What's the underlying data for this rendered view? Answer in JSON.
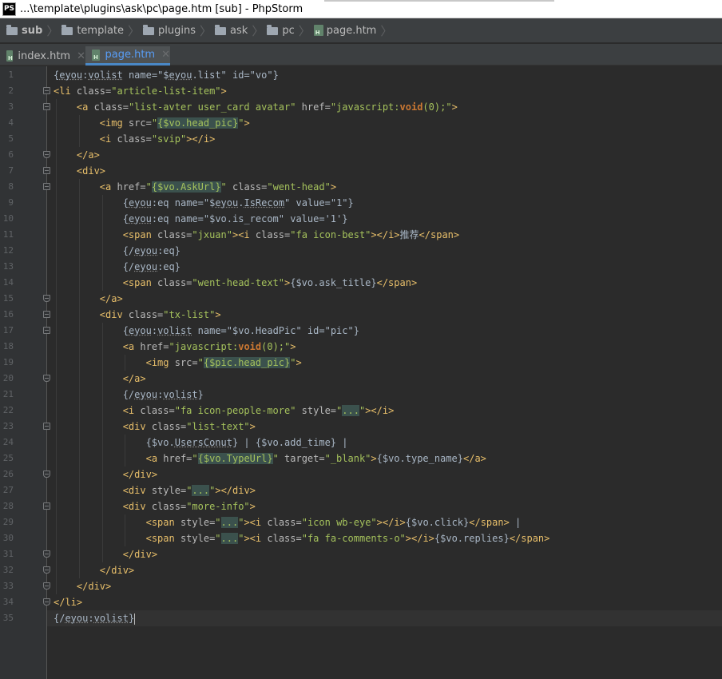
{
  "window": {
    "app_icon": "PS",
    "title": "...\\template\\plugins\\ask\\pc\\page.htm [sub] - PhpStorm"
  },
  "breadcrumb": [
    "sub",
    "template",
    "plugins",
    "ask",
    "pc",
    "page.htm"
  ],
  "tabs": [
    {
      "label": "index.htm",
      "active": false
    },
    {
      "label": "page.htm",
      "active": true
    }
  ],
  "colors": {
    "background": "#2b2b2b",
    "tag": "#e8bf6a",
    "attr_value": "#a5c25c",
    "keyword": "#cc7832",
    "active_tab": "#589df6"
  },
  "code": {
    "line_numbers": [
      "1",
      "2",
      "3",
      "4",
      "5",
      "6",
      "7",
      "8",
      "9",
      "10",
      "11",
      "12",
      "13",
      "14",
      "15",
      "16",
      "17",
      "18",
      "19",
      "20",
      "21",
      "22",
      "23",
      "24",
      "25",
      "26",
      "27",
      "28",
      "29",
      "30",
      "31",
      "32",
      "33",
      "34",
      "35"
    ],
    "lines": [
      [
        {
          "t": "{"
        },
        {
          "t": "eyou",
          "c": "ey"
        },
        {
          "t": ":"
        },
        {
          "t": "volist",
          "c": "ey"
        },
        {
          "t": " name=\"$"
        },
        {
          "t": "eyou",
          "c": "ey"
        },
        {
          "t": ".list\" id=\"vo\"}"
        }
      ],
      [
        {
          "t": "<li",
          "c": "tg"
        },
        {
          "t": " class=",
          "c": "an"
        },
        {
          "t": "\"article-list-item\"",
          "c": "av"
        },
        {
          "t": ">",
          "c": "tg"
        }
      ],
      [
        {
          "t": "<a",
          "c": "tg"
        },
        {
          "t": " class=",
          "c": "an"
        },
        {
          "t": "\"list-avter user_card avatar\"",
          "c": "av"
        },
        {
          "t": " href=",
          "c": "an"
        },
        {
          "t": "\"javascript:",
          "c": "av"
        },
        {
          "t": "void",
          "c": "kw"
        },
        {
          "t": "(0);",
          "c": "av"
        },
        {
          "t": "\"",
          "c": "av"
        },
        {
          "t": ">",
          "c": "tg"
        }
      ],
      [
        {
          "t": "<img",
          "c": "tg"
        },
        {
          "t": " src=",
          "c": "an"
        },
        {
          "t": "\"",
          "c": "av"
        },
        {
          "t": "{$vo.head_pic}",
          "c": "av hl"
        },
        {
          "t": "\"",
          "c": "av"
        },
        {
          "t": ">",
          "c": "tg"
        }
      ],
      [
        {
          "t": "<i",
          "c": "tg"
        },
        {
          "t": " class=",
          "c": "an"
        },
        {
          "t": "\"svip\"",
          "c": "av"
        },
        {
          "t": "></i>",
          "c": "tg"
        }
      ],
      [
        {
          "t": "</a>",
          "c": "tg"
        }
      ],
      [
        {
          "t": "<div>",
          "c": "tg"
        }
      ],
      [
        {
          "t": "<a",
          "c": "tg"
        },
        {
          "t": " href=",
          "c": "an"
        },
        {
          "t": "\"",
          "c": "av"
        },
        {
          "t": "{$vo.AskUrl}",
          "c": "av hl"
        },
        {
          "t": "\"",
          "c": "av"
        },
        {
          "t": " class=",
          "c": "an"
        },
        {
          "t": "\"went-head\"",
          "c": "av"
        },
        {
          "t": ">",
          "c": "tg"
        }
      ],
      [
        {
          "t": "{"
        },
        {
          "t": "eyou",
          "c": "ey"
        },
        {
          "t": ":eq name=\"$"
        },
        {
          "t": "eyou",
          "c": "ey"
        },
        {
          "t": "."
        },
        {
          "t": "IsRecom",
          "c": "ey"
        },
        {
          "t": "\" value=\"1\"}"
        }
      ],
      [
        {
          "t": "{"
        },
        {
          "t": "eyou",
          "c": "ey"
        },
        {
          "t": ":eq name=\"$vo.is_recom\" value='1'}"
        }
      ],
      [
        {
          "t": "<span",
          "c": "tg"
        },
        {
          "t": " class=",
          "c": "an"
        },
        {
          "t": "\"jxuan\"",
          "c": "av"
        },
        {
          "t": "><i",
          "c": "tg"
        },
        {
          "t": " class=",
          "c": "an"
        },
        {
          "t": "\"fa icon-best\"",
          "c": "av"
        },
        {
          "t": "></i>",
          "c": "tg"
        },
        {
          "t": "推荐"
        },
        {
          "t": "</span>",
          "c": "tg"
        }
      ],
      [
        {
          "t": "{/"
        },
        {
          "t": "eyou",
          "c": "ey"
        },
        {
          "t": ":eq}"
        }
      ],
      [
        {
          "t": "{/"
        },
        {
          "t": "eyou",
          "c": "ey"
        },
        {
          "t": ":eq}"
        }
      ],
      [
        {
          "t": "<span",
          "c": "tg"
        },
        {
          "t": " class=",
          "c": "an"
        },
        {
          "t": "\"went-head-text\"",
          "c": "av"
        },
        {
          "t": ">",
          "c": "tg"
        },
        {
          "t": "{$vo.ask_title}"
        },
        {
          "t": "</span>",
          "c": "tg"
        }
      ],
      [
        {
          "t": "</a>",
          "c": "tg"
        }
      ],
      [
        {
          "t": "<div",
          "c": "tg"
        },
        {
          "t": " class=",
          "c": "an"
        },
        {
          "t": "\"tx-list\"",
          "c": "av"
        },
        {
          "t": ">",
          "c": "tg"
        }
      ],
      [
        {
          "t": "{"
        },
        {
          "t": "eyou",
          "c": "ey"
        },
        {
          "t": ":"
        },
        {
          "t": "volist",
          "c": "ey"
        },
        {
          "t": " name=\"$vo.HeadPic\" id=\"pic\"}"
        }
      ],
      [
        {
          "t": "<a",
          "c": "tg"
        },
        {
          "t": " href=",
          "c": "an"
        },
        {
          "t": "\"javascript:",
          "c": "av"
        },
        {
          "t": "void",
          "c": "kw"
        },
        {
          "t": "(0);\"",
          "c": "av"
        },
        {
          "t": ">",
          "c": "tg"
        }
      ],
      [
        {
          "t": "<img",
          "c": "tg"
        },
        {
          "t": " src=",
          "c": "an"
        },
        {
          "t": "\"",
          "c": "av"
        },
        {
          "t": "{$pic.head_pic}",
          "c": "av hl"
        },
        {
          "t": "\"",
          "c": "av"
        },
        {
          "t": ">",
          "c": "tg"
        }
      ],
      [
        {
          "t": "</a>",
          "c": "tg"
        }
      ],
      [
        {
          "t": "{/"
        },
        {
          "t": "eyou",
          "c": "ey"
        },
        {
          "t": ":"
        },
        {
          "t": "volist",
          "c": "ey"
        },
        {
          "t": "}"
        }
      ],
      [
        {
          "t": "<i",
          "c": "tg"
        },
        {
          "t": " class=",
          "c": "an"
        },
        {
          "t": "\"fa icon-people-more\"",
          "c": "av"
        },
        {
          "t": " style=",
          "c": "an"
        },
        {
          "t": "\"",
          "c": "av"
        },
        {
          "t": "...",
          "c": "av hl"
        },
        {
          "t": "\"",
          "c": "av"
        },
        {
          "t": "></i>",
          "c": "tg"
        }
      ],
      [
        {
          "t": "<div",
          "c": "tg"
        },
        {
          "t": " class=",
          "c": "an"
        },
        {
          "t": "\"list-text\"",
          "c": "av"
        },
        {
          "t": ">",
          "c": "tg"
        }
      ],
      [
        {
          "t": "{$vo."
        },
        {
          "t": "UsersConut",
          "c": "ey"
        },
        {
          "t": "} | {$vo.add_time} |"
        }
      ],
      [
        {
          "t": "<a",
          "c": "tg"
        },
        {
          "t": " href=",
          "c": "an"
        },
        {
          "t": "\"",
          "c": "av"
        },
        {
          "t": "{$vo.TypeUrl}",
          "c": "av hl"
        },
        {
          "t": "\"",
          "c": "av"
        },
        {
          "t": " target=",
          "c": "an"
        },
        {
          "t": "\"_blank\"",
          "c": "av"
        },
        {
          "t": ">",
          "c": "tg"
        },
        {
          "t": "{$vo.type_name}"
        },
        {
          "t": "</a>",
          "c": "tg"
        }
      ],
      [
        {
          "t": "</div>",
          "c": "tg"
        }
      ],
      [
        {
          "t": "<div",
          "c": "tg"
        },
        {
          "t": " style=",
          "c": "an"
        },
        {
          "t": "\"",
          "c": "av"
        },
        {
          "t": "...",
          "c": "av hl"
        },
        {
          "t": "\"",
          "c": "av"
        },
        {
          "t": "></div>",
          "c": "tg"
        }
      ],
      [
        {
          "t": "<div",
          "c": "tg"
        },
        {
          "t": " class=",
          "c": "an"
        },
        {
          "t": "\"more-info\"",
          "c": "av"
        },
        {
          "t": ">",
          "c": "tg"
        }
      ],
      [
        {
          "t": "<span",
          "c": "tg"
        },
        {
          "t": " style=",
          "c": "an"
        },
        {
          "t": "\"",
          "c": "av"
        },
        {
          "t": "...",
          "c": "av hl"
        },
        {
          "t": "\"",
          "c": "av"
        },
        {
          "t": "><i",
          "c": "tg"
        },
        {
          "t": " class=",
          "c": "an"
        },
        {
          "t": "\"icon wb-eye\"",
          "c": "av"
        },
        {
          "t": "></i>",
          "c": "tg"
        },
        {
          "t": "{$vo.click}"
        },
        {
          "t": "</span>",
          "c": "tg"
        },
        {
          "t": " |"
        }
      ],
      [
        {
          "t": "<span",
          "c": "tg"
        },
        {
          "t": " style=",
          "c": "an"
        },
        {
          "t": "\"",
          "c": "av"
        },
        {
          "t": "...",
          "c": "av hl"
        },
        {
          "t": "\"",
          "c": "av"
        },
        {
          "t": "><i",
          "c": "tg"
        },
        {
          "t": " class=",
          "c": "an"
        },
        {
          "t": "\"fa fa-comments-o\"",
          "c": "av"
        },
        {
          "t": "></i>",
          "c": "tg"
        },
        {
          "t": "{$vo.replies}"
        },
        {
          "t": "</span>",
          "c": "tg"
        }
      ],
      [
        {
          "t": "</div>",
          "c": "tg"
        }
      ],
      [
        {
          "t": "</div>",
          "c": "tg"
        }
      ],
      [
        {
          "t": "</div>",
          "c": "tg"
        }
      ],
      [
        {
          "t": "</li>",
          "c": "tg"
        }
      ],
      [
        {
          "t": "{/"
        },
        {
          "t": "eyou",
          "c": "ey"
        },
        {
          "t": ":"
        },
        {
          "t": "volist",
          "c": "ey"
        },
        {
          "t": "}"
        }
      ]
    ]
  }
}
